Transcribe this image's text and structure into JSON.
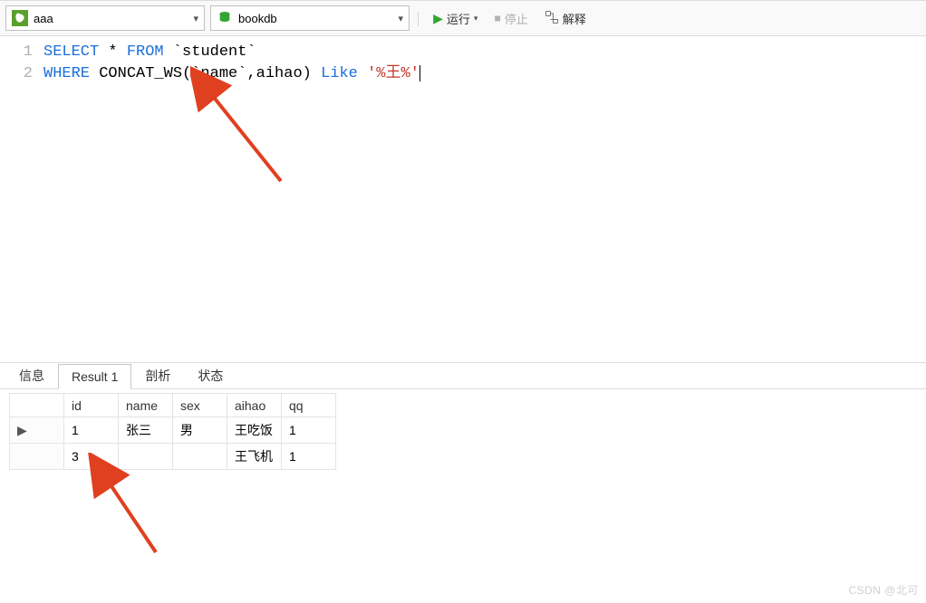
{
  "toolbar": {
    "connection": "aaa",
    "database": "bookdb",
    "run_label": "运行",
    "stop_label": "停止",
    "explain_label": "解释"
  },
  "editor": {
    "lines": [
      "1",
      "2"
    ],
    "code": {
      "l1_kw1": "SELECT",
      "l1_txt1": " * ",
      "l1_kw2": "FROM",
      "l1_txt2": " `student`",
      "l2_kw1": "WHERE",
      "l2_txt1": " CONCAT_WS(`name`,aihao) ",
      "l2_kw2": "Like",
      "l2_txt2": " ",
      "l2_str": "'%王%'"
    }
  },
  "tabs": {
    "info": "信息",
    "result": "Result 1",
    "profile": "剖析",
    "status": "状态"
  },
  "result": {
    "columns": {
      "id": "id",
      "name": "name",
      "sex": "sex",
      "aihao": "aihao",
      "qq": "qq"
    },
    "rows": [
      {
        "marker": "▶",
        "id": "1",
        "name": "张三",
        "sex": "男",
        "aihao": "王吃饭",
        "qq": "1"
      },
      {
        "marker": "",
        "id": "3",
        "name": "",
        "sex": "",
        "aihao": "王飞机",
        "qq": "1"
      }
    ]
  },
  "watermark": "CSDN @北可"
}
